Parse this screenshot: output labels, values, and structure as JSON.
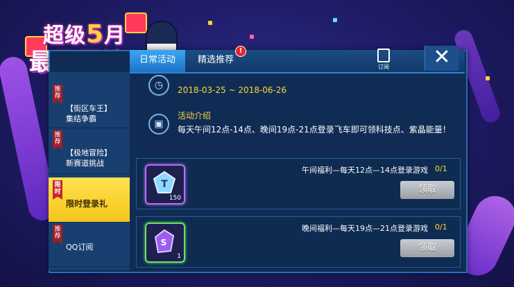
{
  "header": {
    "logo_line1_a": "超级",
    "logo_line1_num": "5",
    "logo_line1_b": "月",
    "logo_line2": "最强回馈"
  },
  "tabs": [
    {
      "label": "日常活动",
      "active": true
    },
    {
      "label": "精选推荐",
      "active": false,
      "badge": "!"
    }
  ],
  "subscribe_label": "订阅",
  "close_glyph": "✕",
  "sidebar": {
    "items": [
      {
        "tag": "推荐",
        "line1": "【街区车王】",
        "line2": "集结争霸",
        "active": false
      },
      {
        "tag": "推荐",
        "line1": "【极地冒险】",
        "line2": "新赛道挑战",
        "active": false
      },
      {
        "tag": "限时",
        "line1": "限时登录礼",
        "line2": "",
        "active": true
      },
      {
        "tag": "推荐",
        "line1": "QQ订阅",
        "line2": "",
        "active": false
      }
    ]
  },
  "activity": {
    "date_range": "2018-03-25 ~ 2018-06-26",
    "intro_title": "活动介绍",
    "intro_body": "每天午间12点-14点、晚间19点-21点登录飞车即可领科技点、紫晶能量！",
    "rewards": [
      {
        "description": "午间福利—每天12点—14点登录游戏",
        "progress": "0/1",
        "item_count": "150",
        "button": "领取",
        "border_color": "#b86cf5"
      },
      {
        "description": "晚间福利—每天19点—21点登录游戏",
        "progress": "0/1",
        "item_count": "1",
        "button": "领取",
        "border_color": "#6be063"
      }
    ]
  },
  "colors": {
    "accent_yellow": "#ffd63a",
    "panel_bg": "#102c55",
    "active_tab": "#3aa7f2",
    "active_side": "#f6c51a"
  }
}
